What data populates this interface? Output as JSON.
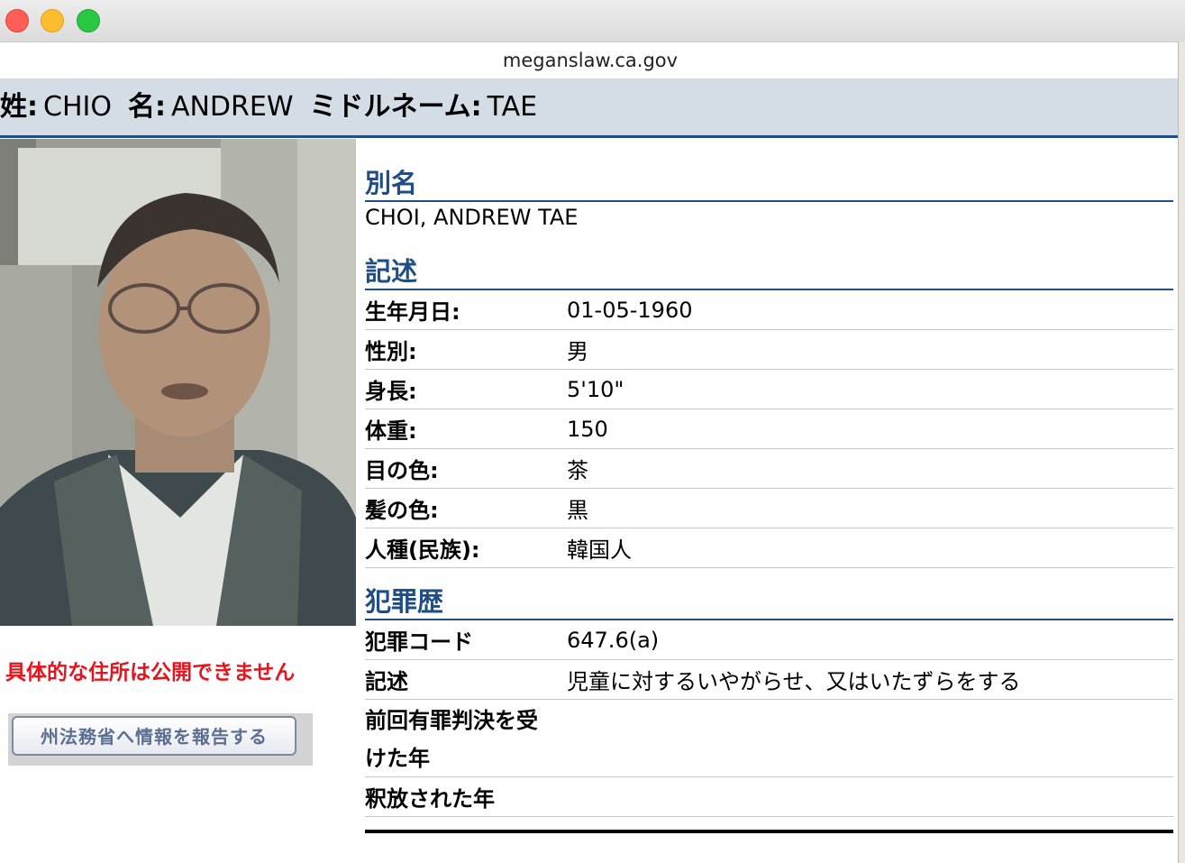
{
  "window": {
    "url": "meganslaw.ca.gov"
  },
  "name_bar": {
    "last_label": "姓:",
    "last_value": "CHIO",
    "first_label": "名:",
    "first_value": "ANDREW",
    "middle_label": "ミドルネーム:",
    "middle_value": "TAE"
  },
  "left": {
    "notice": "具体的な住所は公開できません",
    "report_button": "州法務省へ情報を報告する"
  },
  "alias": {
    "title": "別名",
    "value": "CHOI, ANDREW TAE"
  },
  "description": {
    "title": "記述",
    "rows": [
      {
        "label": "生年月日:",
        "value": "01-05-1960"
      },
      {
        "label": "性別:",
        "value": "男"
      },
      {
        "label": "身長:",
        "value": "5'10\""
      },
      {
        "label": "体重:",
        "value": "150"
      },
      {
        "label": "目の色:",
        "value": "茶"
      },
      {
        "label": "髪の色:",
        "value": "黒"
      },
      {
        "label": "人種(民族):",
        "value": "韓国人"
      }
    ]
  },
  "offenses": {
    "title": "犯罪歴",
    "rows": [
      {
        "label": "犯罪コード",
        "value": "647.6(a)"
      },
      {
        "label": "記述",
        "value": "児童に対するいやがらせ、又はいたずらをする"
      },
      {
        "label": "前回有罪判決を受け た年",
        "label_line1": "前回有罪判決を受",
        "label_line2": "けた年",
        "value": ""
      },
      {
        "label": "釈放された年",
        "value": ""
      }
    ]
  }
}
